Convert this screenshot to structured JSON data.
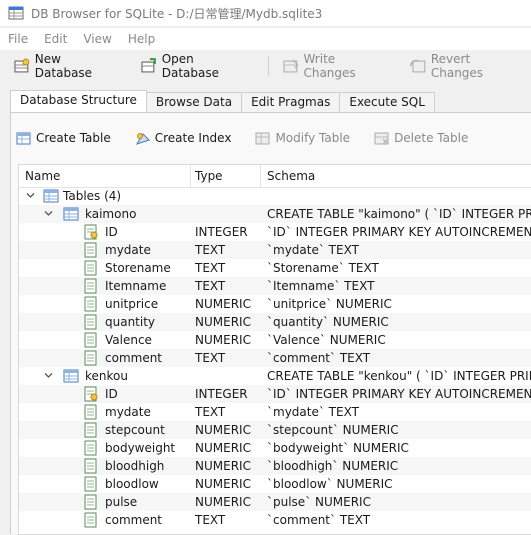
{
  "window": {
    "title": "DB Browser for SQLite - D:/日常管理/Mydb.sqlite3"
  },
  "menu": [
    "File",
    "Edit",
    "View",
    "Help"
  ],
  "toolbar": {
    "new_db": "New Database",
    "open_db": "Open Database",
    "write_changes": "Write Changes",
    "revert_changes": "Revert Changes"
  },
  "tabs": [
    "Database Structure",
    "Browse Data",
    "Edit Pragmas",
    "Execute SQL"
  ],
  "structure_toolbar": {
    "create_table": "Create Table",
    "create_index": "Create Index",
    "modify_table": "Modify Table",
    "delete_table": "Delete Table"
  },
  "columns": {
    "name": "Name",
    "type": "Type",
    "schema": "Schema"
  },
  "tree": {
    "tables_label": "Tables (4)",
    "tables": [
      {
        "name": "kaimono",
        "schema": "CREATE TABLE \"kaimono\" ( `ID` INTEGER PRIMARY",
        "fields": [
          {
            "name": "ID",
            "type": "INTEGER",
            "schema": "`ID` INTEGER PRIMARY KEY AUTOINCREMENT",
            "key": true
          },
          {
            "name": "mydate",
            "type": "TEXT",
            "schema": "`mydate` TEXT"
          },
          {
            "name": "Storename",
            "type": "TEXT",
            "schema": "`Storename` TEXT"
          },
          {
            "name": "Itemname",
            "type": "TEXT",
            "schema": "`Itemname` TEXT"
          },
          {
            "name": "unitprice",
            "type": "NUMERIC",
            "schema": "`unitprice` NUMERIC"
          },
          {
            "name": "quantity",
            "type": "NUMERIC",
            "schema": "`quantity` NUMERIC"
          },
          {
            "name": "Valence",
            "type": "NUMERIC",
            "schema": "`Valence` NUMERIC"
          },
          {
            "name": "comment",
            "type": "TEXT",
            "schema": "`comment` TEXT"
          }
        ]
      },
      {
        "name": "kenkou",
        "schema": "CREATE TABLE \"kenkou\" ( `ID` INTEGER PRIMARY K",
        "fields": [
          {
            "name": "ID",
            "type": "INTEGER",
            "schema": "`ID` INTEGER PRIMARY KEY AUTOINCREMENT",
            "key": true
          },
          {
            "name": "mydate",
            "type": "TEXT",
            "schema": "`mydate` TEXT"
          },
          {
            "name": "stepcount",
            "type": "NUMERIC",
            "schema": "`stepcount` NUMERIC"
          },
          {
            "name": "bodyweight",
            "type": "NUMERIC",
            "schema": "`bodyweight` NUMERIC"
          },
          {
            "name": "bloodhigh",
            "type": "NUMERIC",
            "schema": "`bloodhigh` NUMERIC"
          },
          {
            "name": "bloodlow",
            "type": "NUMERIC",
            "schema": "`bloodlow` NUMERIC"
          },
          {
            "name": "pulse",
            "type": "NUMERIC",
            "schema": "`pulse` NUMERIC"
          },
          {
            "name": "comment",
            "type": "TEXT",
            "schema": "`comment` TEXT"
          }
        ]
      }
    ]
  },
  "colors": {
    "accent": "#3a7bd5",
    "disabled_text": "#8a8a8a",
    "row_alt": "#f6f6f6"
  }
}
